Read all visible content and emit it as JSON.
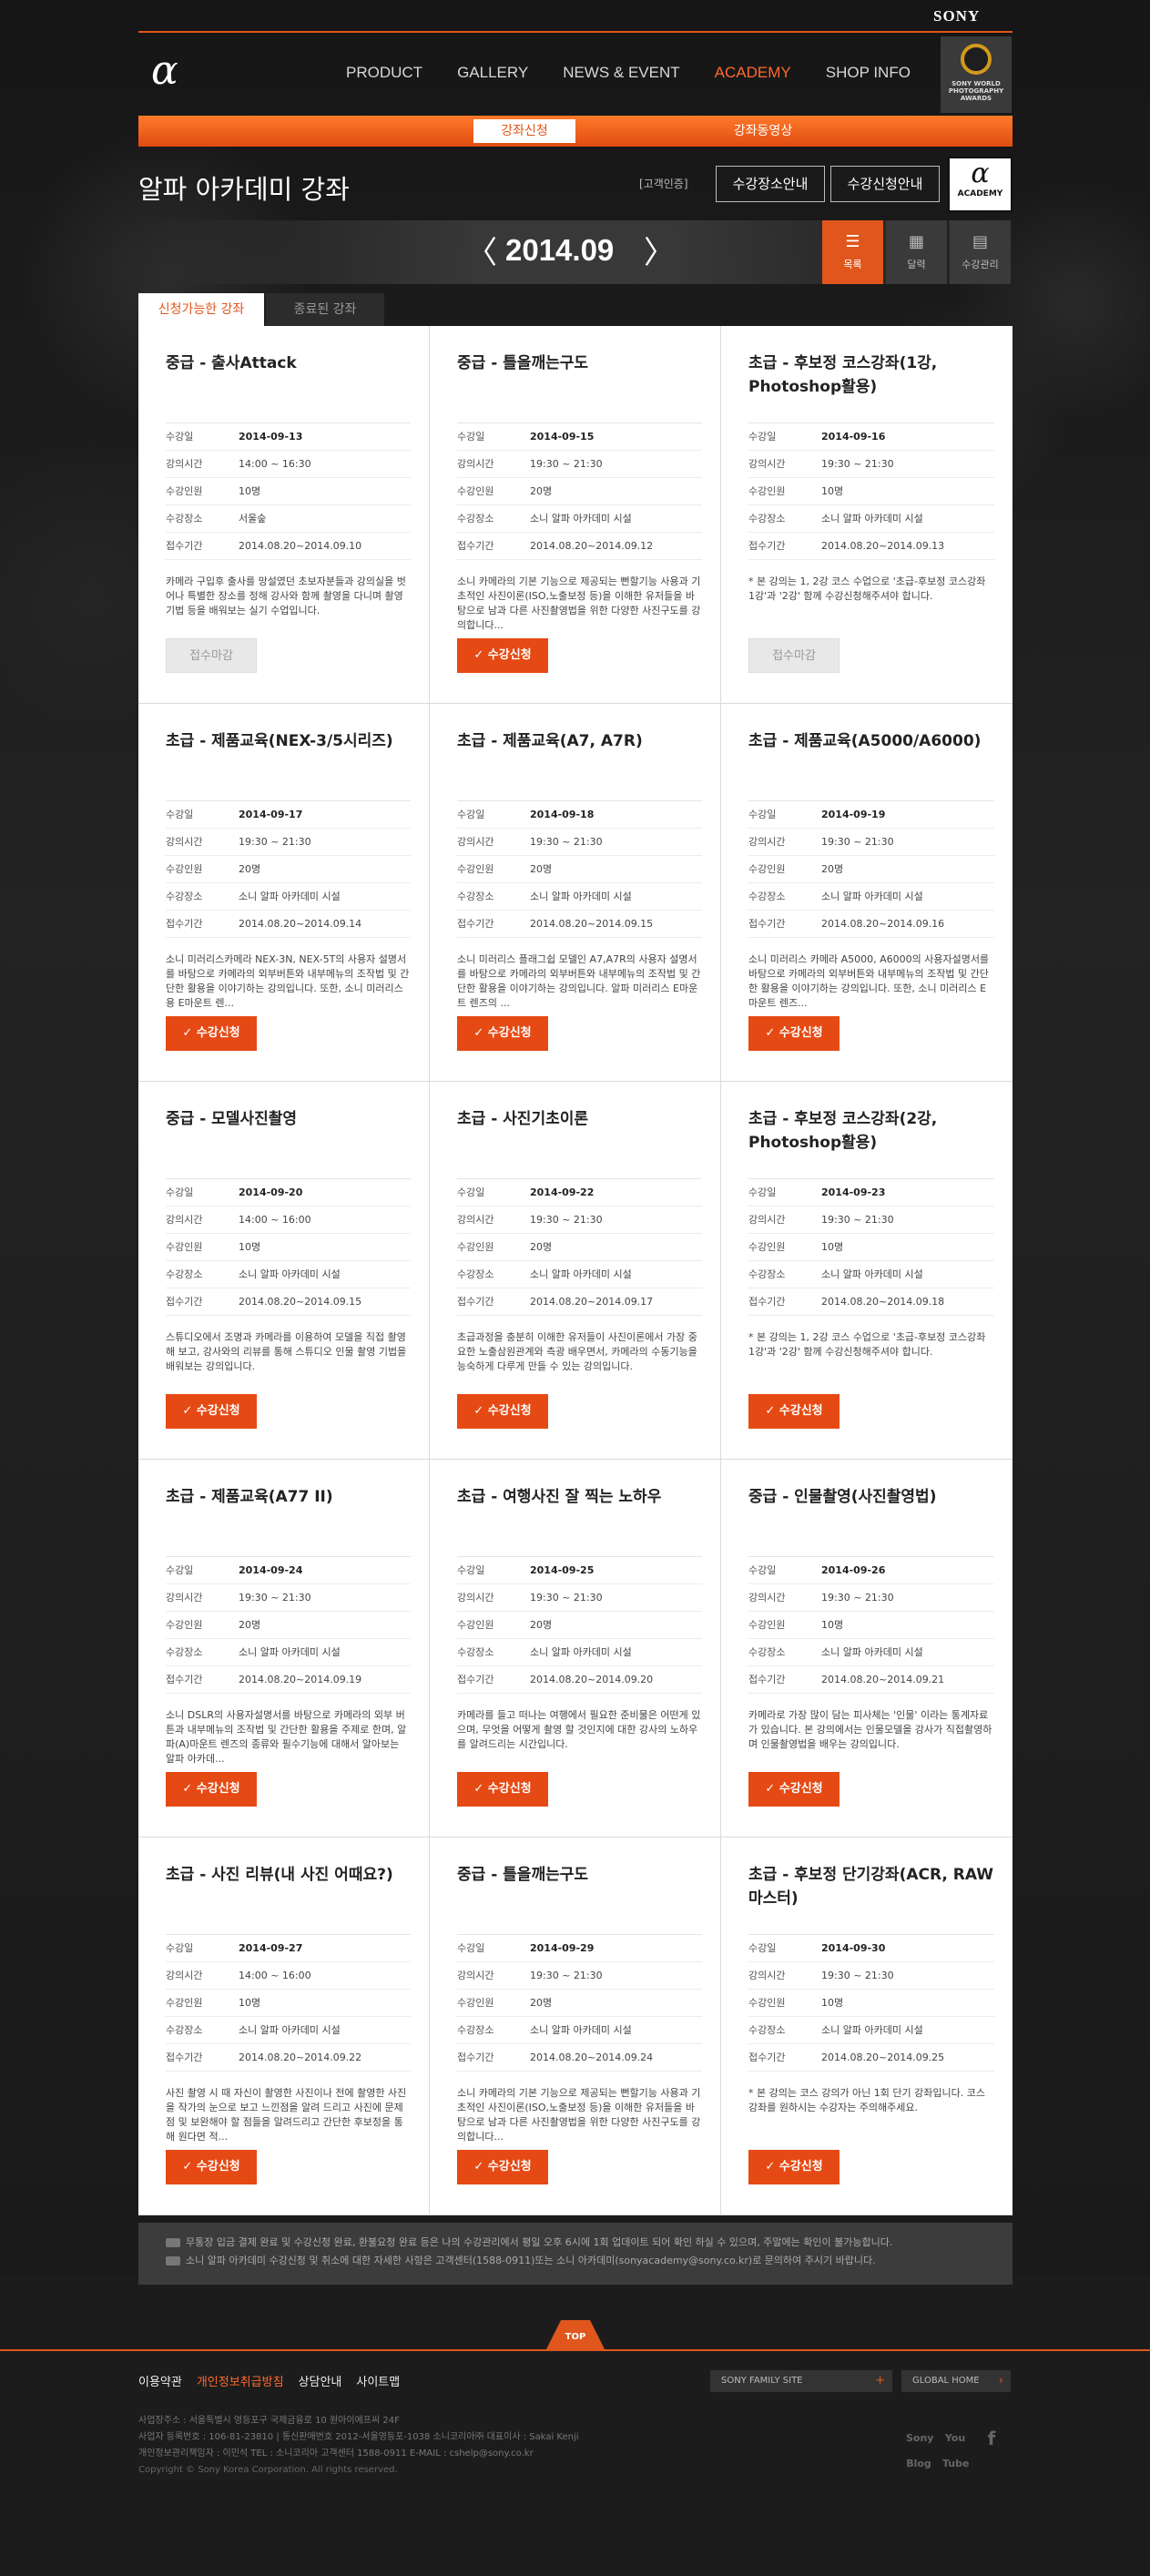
{
  "brand": {
    "sony": "SONY",
    "alpha": "α"
  },
  "nav": [
    "PRODUCT",
    "GALLERY",
    "NEWS & EVENT",
    "ACADEMY",
    "SHOP INFO"
  ],
  "award": "SONY WORLD PHOTOGRAPHY AWARDS",
  "subtabs": {
    "active": "강좌신청",
    "other": "강좌동영상"
  },
  "header": {
    "title": "알파 아카데미 강좌",
    "cert": "[고객인증]",
    "btn_location": "수강장소안내",
    "btn_guide": "수강신청안내",
    "badge_alpha": "α",
    "badge_text": "ACADEMY"
  },
  "month": {
    "label": "2014.09",
    "prev": "〈",
    "next": "〉"
  },
  "views": [
    {
      "label": "목록",
      "icon": "☰"
    },
    {
      "label": "달력",
      "icon": "▦"
    },
    {
      "label": "수강관리",
      "icon": "▤"
    }
  ],
  "list_tabs": {
    "active": "신청가능한 강좌",
    "other": "종료된 강좌"
  },
  "field_labels": {
    "date": "수강일",
    "time": "강의시간",
    "capacity": "수강인원",
    "place": "수강장소",
    "period": "접수기간"
  },
  "courses": [
    {
      "title": "중급 - 출사Attack",
      "date": "2014-09-13",
      "time": "14:00 ~ 16:30",
      "capacity": "10명",
      "place": "서울숲",
      "period": "2014.08.20~2014.09.10",
      "desc": "카메라 구입후 출사를 망설였던 초보자분들과 강의실을 벗어나 특별한 장소를 정해 강사와 함께 촬영을 다니며 촬영기법 등을 배워보는 실기 수업입니다.",
      "status": "closed",
      "button": "접수마감"
    },
    {
      "title": "중급 - 틀을깨는구도",
      "date": "2014-09-15",
      "time": "19:30 ~ 21:30",
      "capacity": "20명",
      "place": "소니 알파 아카데미 시설",
      "period": "2014.08.20~2014.09.12",
      "desc": "소니 카메라의 기본 기능으로 제공되는 뻔할기능 사용과 기초적인 사진이론(ISO,노출보정 등)을 이해한 유저들을 바탕으로 남과 다른 사진촬영법을 위한 다양한 사진구도를 강의합니다...",
      "status": "open",
      "button": "수강신청"
    },
    {
      "title": "초급 - 후보정 코스강좌(1강, Photoshop활용)",
      "date": "2014-09-16",
      "time": "19:30 ~ 21:30",
      "capacity": "10명",
      "place": "소니 알파 아카데미 시설",
      "period": "2014.08.20~2014.09.13",
      "desc": "* 본 강의는 1, 2강 코스 수업으로 '초급-후보정 코스강좌 1강'과 '2강' 함께 수강신청해주셔야 합니다.",
      "status": "closed",
      "button": "접수마감"
    },
    {
      "title": "초급 - 제품교육(NEX-3/5시리즈)",
      "date": "2014-09-17",
      "time": "19:30 ~ 21:30",
      "capacity": "20명",
      "place": "소니 알파 아카데미 시설",
      "period": "2014.08.20~2014.09.14",
      "desc": "소니 미러리스카메라 NEX-3N, NEX-5T의 사용자 설명서를 바탕으로 카메라의 외부버튼와 내부메뉴의 조작법 및 간단한 활용을 이야기하는 강의입니다. 또한, 소니 미러리스용 E마운트 렌...",
      "status": "open",
      "button": "수강신청"
    },
    {
      "title": "초급 - 제품교육(A7, A7R)",
      "date": "2014-09-18",
      "time": "19:30 ~ 21:30",
      "capacity": "20명",
      "place": "소니 알파 아카데미 시설",
      "period": "2014.08.20~2014.09.15",
      "desc": "소니 미러리스 플래그쉽 모델인 A7,A7R의 사용자 설명서를 바탕으로 카메라의 외부버튼와 내부메뉴의 조작법 및 간단한 활용을 이야기하는 강의입니다. 알파 미러리스 E마운트 렌즈의 ...",
      "status": "open",
      "button": "수강신청"
    },
    {
      "title": "초급 - 제품교육(A5000/A6000)",
      "date": "2014-09-19",
      "time": "19:30 ~ 21:30",
      "capacity": "20명",
      "place": "소니 알파 아카데미 시설",
      "period": "2014.08.20~2014.09.16",
      "desc": "소니 미러리스 카메라 A5000, A6000의 사용자설명서를 바탕으로 카메라의 외부버튼와 내부메뉴의 조작법 및 간단한 활용을 이야기하는 강의입니다. 또한, 소니 미러리스 E마운트 렌즈...",
      "status": "open",
      "button": "수강신청"
    },
    {
      "title": "중급 - 모델사진촬영",
      "date": "2014-09-20",
      "time": "14:00 ~ 16:00",
      "capacity": "10명",
      "place": "소니 알파 아카데미 시설",
      "period": "2014.08.20~2014.09.15",
      "desc": "스튜디오에서 조명과 카메라를 이용하여 모델을 직접 촬영해 보고, 강사와의 리뷰를 통해 스튜디오 인물 촬영 기법을 배워보는 강의입니다.",
      "status": "open",
      "button": "수강신청"
    },
    {
      "title": "초급 - 사진기초이론",
      "date": "2014-09-22",
      "time": "19:30 ~ 21:30",
      "capacity": "20명",
      "place": "소니 알파 아카데미 시설",
      "period": "2014.08.20~2014.09.17",
      "desc": "초급과정을 충분히 이해한 유저들이 사진이론에서 가장 중요한 노출삼원관계와 측광 배우면서, 카메라의 수동기능을 능숙하게 다루게 만들 수 있는 강의입니다.",
      "status": "open",
      "button": "수강신청"
    },
    {
      "title": "초급 - 후보정 코스강좌(2강, Photoshop활용)",
      "date": "2014-09-23",
      "time": "19:30 ~ 21:30",
      "capacity": "10명",
      "place": "소니 알파 아카데미 시설",
      "period": "2014.08.20~2014.09.18",
      "desc": "* 본 강의는 1, 2강 코스 수업으로 '초급-후보정 코스강좌 1강'과 '2강' 함께 수강신청해주셔야 합니다.",
      "status": "open",
      "button": "수강신청"
    },
    {
      "title": "초급 - 제품교육(A77 II)",
      "date": "2014-09-24",
      "time": "19:30 ~ 21:30",
      "capacity": "20명",
      "place": "소니 알파 아카데미 시설",
      "period": "2014.08.20~2014.09.19",
      "desc": "소니 DSLR의 사용자설명서를 바탕으로 카메라의 외부 버튼과 내부메뉴의 조작법 및 간단한 활용을 주제로 한며, 알파(A)마운트 렌즈의 종류와 필수기능에 대해서 알아보는 알파 아카데...",
      "status": "open",
      "button": "수강신청"
    },
    {
      "title": "초급 - 여행사진 잘 찍는 노하우",
      "date": "2014-09-25",
      "time": "19:30 ~ 21:30",
      "capacity": "20명",
      "place": "소니 알파 아카데미 시설",
      "period": "2014.08.20~2014.09.20",
      "desc": "카메라를 들고 떠나는 여행에서 필요한 준비물은 어떤게 있으며, 무엇을 어떻게 촬영 할 것인지에 대한 강사의 노하우를 알려드리는 시간입니다.",
      "status": "open",
      "button": "수강신청"
    },
    {
      "title": "중급 - 인물촬영(사진촬영법)",
      "date": "2014-09-26",
      "time": "19:30 ~ 21:30",
      "capacity": "10명",
      "place": "소니 알파 아카데미 시설",
      "period": "2014.08.20~2014.09.21",
      "desc": "카메라로 가장 많이 담는 피사체는 '인물' 이라는 통계자료가 있습니다. 본 강의에서는 인물모델을 강사가 직접촬영하며 인물촬영법을 배우는 강의입니다.",
      "status": "open",
      "button": "수강신청"
    },
    {
      "title": "초급 - 사진 리뷰(내 사진 어때요?)",
      "date": "2014-09-27",
      "time": "14:00 ~ 16:00",
      "capacity": "10명",
      "place": "소니 알파 아카데미 시설",
      "period": "2014.08.20~2014.09.22",
      "desc": "사진 촬영 시 때 자신이 촬영한 사진이나 전에 촬영한 사진을 작가의 눈으로 보고 느낀점을 알려 드리고 사진에 문제점 및 보완해야 할 점들을 알려드리고 간단한 후보정을 통해 원다면 적...",
      "status": "open",
      "button": "수강신청"
    },
    {
      "title": "중급 - 틀을깨는구도",
      "date": "2014-09-29",
      "time": "19:30 ~ 21:30",
      "capacity": "20명",
      "place": "소니 알파 아카데미 시설",
      "period": "2014.08.20~2014.09.24",
      "desc": "소니 카메라의 기본 기능으로 제공되는 뻔할기능 사용과 기초적인 사진이론(ISO,노출보정 등)을 이해한 유저들을 바탕으로 남과 다른 사진촬영법을 위한 다양한 사진구도를 강의합니다...",
      "status": "open",
      "button": "수강신청"
    },
    {
      "title": "초급 - 후보정 단기강좌(ACR, RAW 마스터)",
      "date": "2014-09-30",
      "time": "19:30 ~ 21:30",
      "capacity": "10명",
      "place": "소니 알파 아카데미 시설",
      "period": "2014.08.20~2014.09.25",
      "desc": "* 본 강의는 코스 강의가 아닌 1회 단기 강좌입니다. 코스 강좌를 원하시는 수강자는 주의해주세요.",
      "status": "open",
      "button": "수강신청"
    }
  ],
  "notice": [
    "무통장 입금 결제 완료 및 수강신청 완료, 환불요청 완료 등은 나의 수강관리에서 평일 오후 6시에 1회 업데이트 되어 확인 하실 수 있으며, 주말에는 확인이 불가능합니다.",
    "소니 알파 아카데미 수강신청 및 취소에 대한 자세한 사항은 고객센터(1588-0911)또는 소니 아카데미(sonyacademy@sony.co.kr)로 문의하여 주시기 바랍니다."
  ],
  "footer": {
    "top": "TOP",
    "links": [
      "이용약관",
      "개인정보취급방침",
      "상담안내",
      "사이트맵"
    ],
    "family": "SONY FAMILY SITE",
    "global": "GLOBAL HOME",
    "info": [
      "사업장주소 : 서울특별시 영등포구 국제금융로 10 원아이에프씨 24F",
      "사업자 등록번호 : 106-81-23810 | 통신판매번호 2012-서울영등포-1038 소니코리아㈜ 대표이사 : Sakai Kenji",
      "개인정보관리책임자 : 이민석 TEL : 소니코리아 고객센터 1588-0911 E-MAIL : cshelp@sony.co.kr",
      "Copyright © Sony Korea Corporation. All rights reserved."
    ],
    "social": [
      "Sony Blog",
      "You Tube",
      "f"
    ]
  },
  "colors": {
    "accent": "#e0561c",
    "background": "#1c1c1c"
  }
}
